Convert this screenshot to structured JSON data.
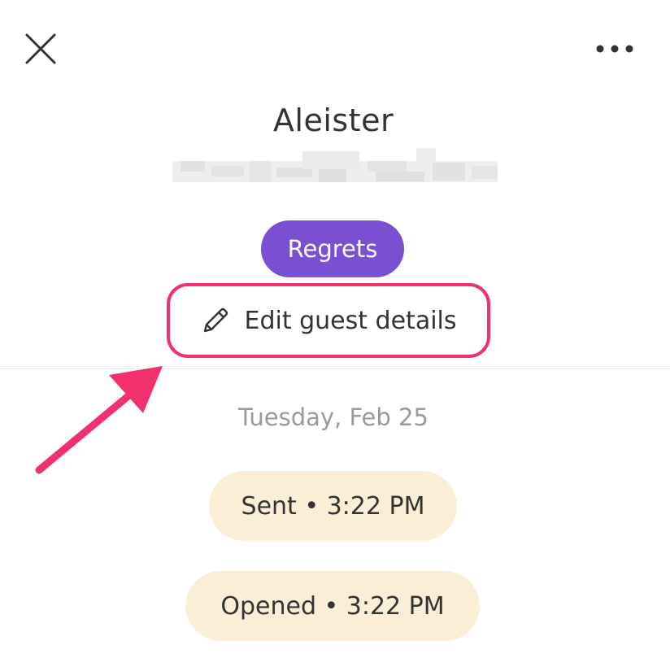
{
  "header": {
    "close_icon": "close-icon",
    "more_icon": "more-horizontal-icon"
  },
  "guest": {
    "name": "Aleister",
    "status": "Regrets"
  },
  "actions": {
    "edit_label": "Edit guest details",
    "edit_icon": "pencil-icon"
  },
  "activity": {
    "date": "Tuesday, Feb 25",
    "events": [
      {
        "label": "Sent • 3:22 PM"
      },
      {
        "label": "Opened • 3:22 PM"
      }
    ]
  },
  "colors": {
    "status_badge": "#7a4fd1",
    "highlight": "#f0316e",
    "pill_background": "#fbeed7",
    "date_text": "#9a9a9a"
  }
}
